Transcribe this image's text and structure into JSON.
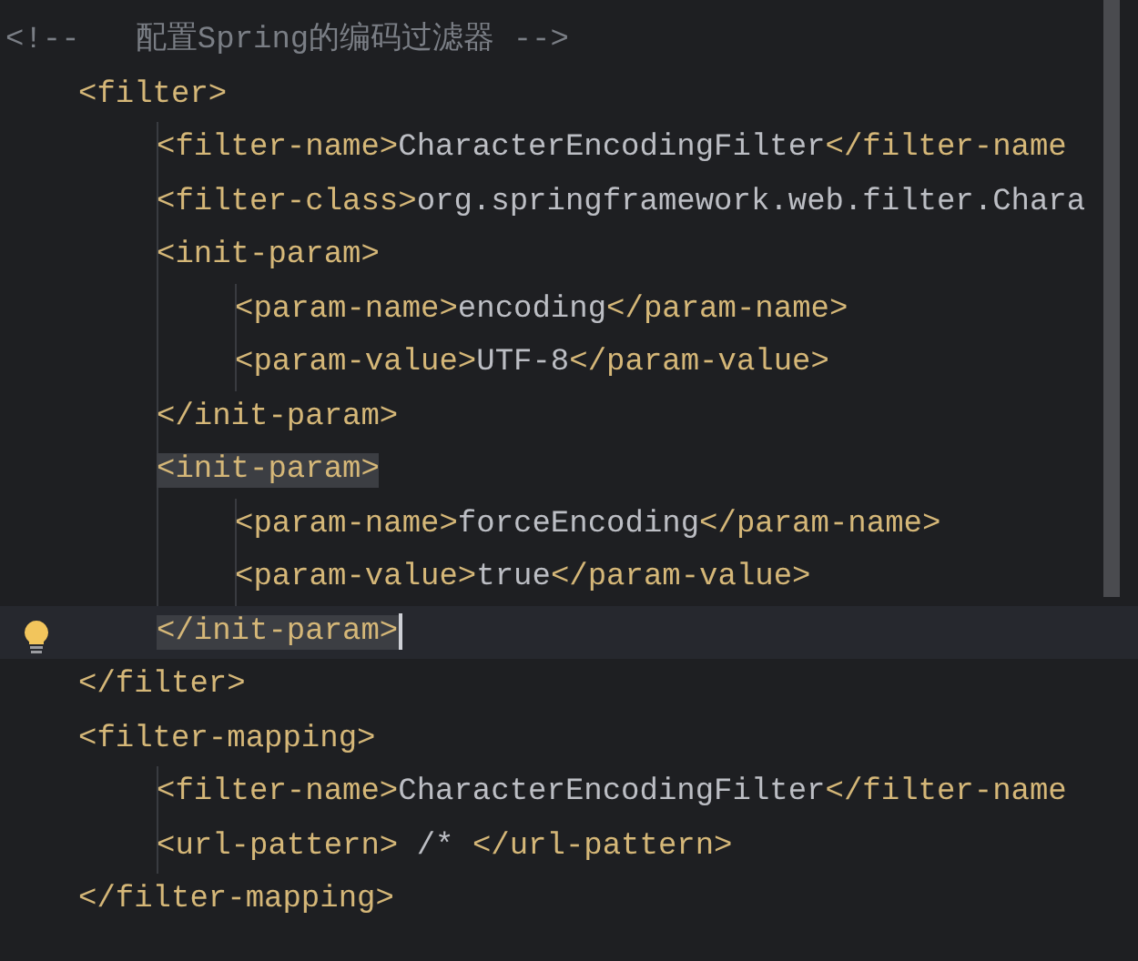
{
  "lines": [
    {
      "kind": "comment",
      "segments": [
        {
          "kind": "comment",
          "text": "<!--   配置Spring的编码过滤器 -->"
        }
      ]
    },
    {
      "kind": "code",
      "segments": [
        {
          "kind": "tag",
          "text": "<filter>"
        }
      ],
      "children": [
        {
          "kind": "code",
          "segments": [
            {
              "kind": "tag",
              "text": "<filter-name>"
            },
            {
              "kind": "text",
              "text": "CharacterEncodingFilter"
            },
            {
              "kind": "tag",
              "text": "</filter-name"
            }
          ]
        },
        {
          "kind": "code",
          "segments": [
            {
              "kind": "tag",
              "text": "<filter-class>"
            },
            {
              "kind": "text",
              "text": "org.springframework.web.filter.Chara"
            }
          ]
        },
        {
          "kind": "code",
          "segments": [
            {
              "kind": "tag",
              "text": "<init-param>"
            }
          ],
          "children": [
            {
              "kind": "code",
              "segments": [
                {
                  "kind": "tag",
                  "text": "<param-name>"
                },
                {
                  "kind": "text",
                  "text": "encoding"
                },
                {
                  "kind": "tag",
                  "text": "</param-name>"
                }
              ]
            },
            {
              "kind": "code",
              "segments": [
                {
                  "kind": "tag",
                  "text": "<param-value>"
                },
                {
                  "kind": "text",
                  "text": "UTF-8"
                },
                {
                  "kind": "tag",
                  "text": "</param-value>"
                }
              ]
            }
          ]
        },
        {
          "kind": "code",
          "segments": [
            {
              "kind": "tag",
              "text": "</init-param>"
            }
          ]
        },
        {
          "kind": "code",
          "highlighted": true,
          "segments": [
            {
              "kind": "tag",
              "text": "<init-param>"
            }
          ],
          "children": [
            {
              "kind": "code",
              "segments": [
                {
                  "kind": "tag",
                  "text": "<param-name>"
                },
                {
                  "kind": "text",
                  "text": "forceEncoding"
                },
                {
                  "kind": "tag",
                  "text": "</param-name>"
                }
              ]
            },
            {
              "kind": "code",
              "segments": [
                {
                  "kind": "tag",
                  "text": "<param-value>"
                },
                {
                  "kind": "text",
                  "text": "true"
                },
                {
                  "kind": "tag",
                  "text": "</param-value>"
                }
              ]
            }
          ]
        },
        {
          "kind": "code",
          "highlighted": true,
          "current": true,
          "segments": [
            {
              "kind": "tag",
              "text": "</init-param>"
            }
          ]
        }
      ]
    },
    {
      "kind": "code",
      "segments": [
        {
          "kind": "tag",
          "text": "</filter>"
        }
      ]
    },
    {
      "kind": "code",
      "segments": [
        {
          "kind": "tag",
          "text": "<filter-mapping>"
        }
      ],
      "children": [
        {
          "kind": "code",
          "segments": [
            {
              "kind": "tag",
              "text": "<filter-name>"
            },
            {
              "kind": "text",
              "text": "CharacterEncodingFilter"
            },
            {
              "kind": "tag",
              "text": "</filter-name"
            }
          ]
        },
        {
          "kind": "code",
          "segments": [
            {
              "kind": "tag",
              "text": "<url-pattern>"
            },
            {
              "kind": "text",
              "text": " /* "
            },
            {
              "kind": "tag",
              "text": "</url-pattern>"
            }
          ]
        }
      ]
    },
    {
      "kind": "code",
      "segments": [
        {
          "kind": "tag",
          "text": "</filter-mapping>"
        }
      ]
    }
  ]
}
